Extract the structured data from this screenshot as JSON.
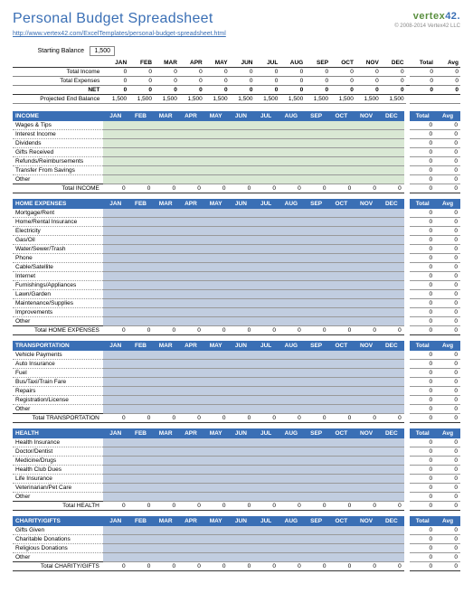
{
  "header": {
    "title": "Personal Budget Spreadsheet",
    "url": "http://www.vertex42.com/ExcelTemplates/personal-budget-spreadsheet.html",
    "logo_prefix": "vertex",
    "logo_suffix": "42",
    "copyright": "© 2008-2014 Vertex42 LLC"
  },
  "start": {
    "label": "Starting Balance",
    "value": "1,500"
  },
  "months": [
    "JAN",
    "FEB",
    "MAR",
    "APR",
    "MAY",
    "JUN",
    "JUL",
    "AUG",
    "SEP",
    "OCT",
    "NOV",
    "DEC"
  ],
  "agg_cols": [
    "Total",
    "Avg"
  ],
  "summary": {
    "rows": [
      {
        "label": "Total Income",
        "vals": [
          "0",
          "0",
          "0",
          "0",
          "0",
          "0",
          "0",
          "0",
          "0",
          "0",
          "0",
          "0"
        ],
        "agg": [
          "0",
          "0"
        ]
      },
      {
        "label": "Total Expenses",
        "vals": [
          "0",
          "0",
          "0",
          "0",
          "0",
          "0",
          "0",
          "0",
          "0",
          "0",
          "0",
          "0"
        ],
        "agg": [
          "0",
          "0"
        ]
      }
    ],
    "net": {
      "label": "NET",
      "vals": [
        "0",
        "0",
        "0",
        "0",
        "0",
        "0",
        "0",
        "0",
        "0",
        "0",
        "0",
        "0"
      ],
      "agg": [
        "0",
        "0"
      ]
    },
    "proj": {
      "label": "Projected End Balance",
      "vals": [
        "1,500",
        "1,500",
        "1,500",
        "1,500",
        "1,500",
        "1,500",
        "1,500",
        "1,500",
        "1,500",
        "1,500",
        "1,500",
        "1,500"
      ],
      "agg": [
        "",
        ""
      ]
    }
  },
  "sections": [
    {
      "name": "INCOME",
      "type": "income",
      "total_label": "Total INCOME",
      "cats": [
        "Wages & Tips",
        "Interest Income",
        "Dividends",
        "Gifts Received",
        "Refunds/Reimbursements",
        "Transfer From Savings",
        "Other"
      ]
    },
    {
      "name": "HOME EXPENSES",
      "type": "expense",
      "total_label": "Total HOME EXPENSES",
      "cats": [
        "Mortgage/Rent",
        "Home/Rental Insurance",
        "Electricity",
        "Gas/Oil",
        "Water/Sewer/Trash",
        "Phone",
        "Cable/Satellite",
        "Internet",
        "Furnishings/Appliances",
        "Lawn/Garden",
        "Maintenance/Supplies",
        "Improvements",
        "Other"
      ]
    },
    {
      "name": "TRANSPORTATION",
      "type": "expense",
      "total_label": "Total TRANSPORTATION",
      "cats": [
        "Vehicle Payments",
        "Auto Insurance",
        "Fuel",
        "Bus/Taxi/Train Fare",
        "Repairs",
        "Registration/License",
        "Other"
      ]
    },
    {
      "name": "HEALTH",
      "type": "expense",
      "total_label": "Total HEALTH",
      "cats": [
        "Health Insurance",
        "Doctor/Dentist",
        "Medicine/Drugs",
        "Health Club Dues",
        "Life Insurance",
        "Veterinarian/Pet Care",
        "Other"
      ]
    },
    {
      "name": "CHARITY/GIFTS",
      "type": "expense",
      "total_label": "Total CHARITY/GIFTS",
      "cats": [
        "Gifts Given",
        "Charitable Donations",
        "Religious Donations",
        "Other"
      ]
    }
  ]
}
